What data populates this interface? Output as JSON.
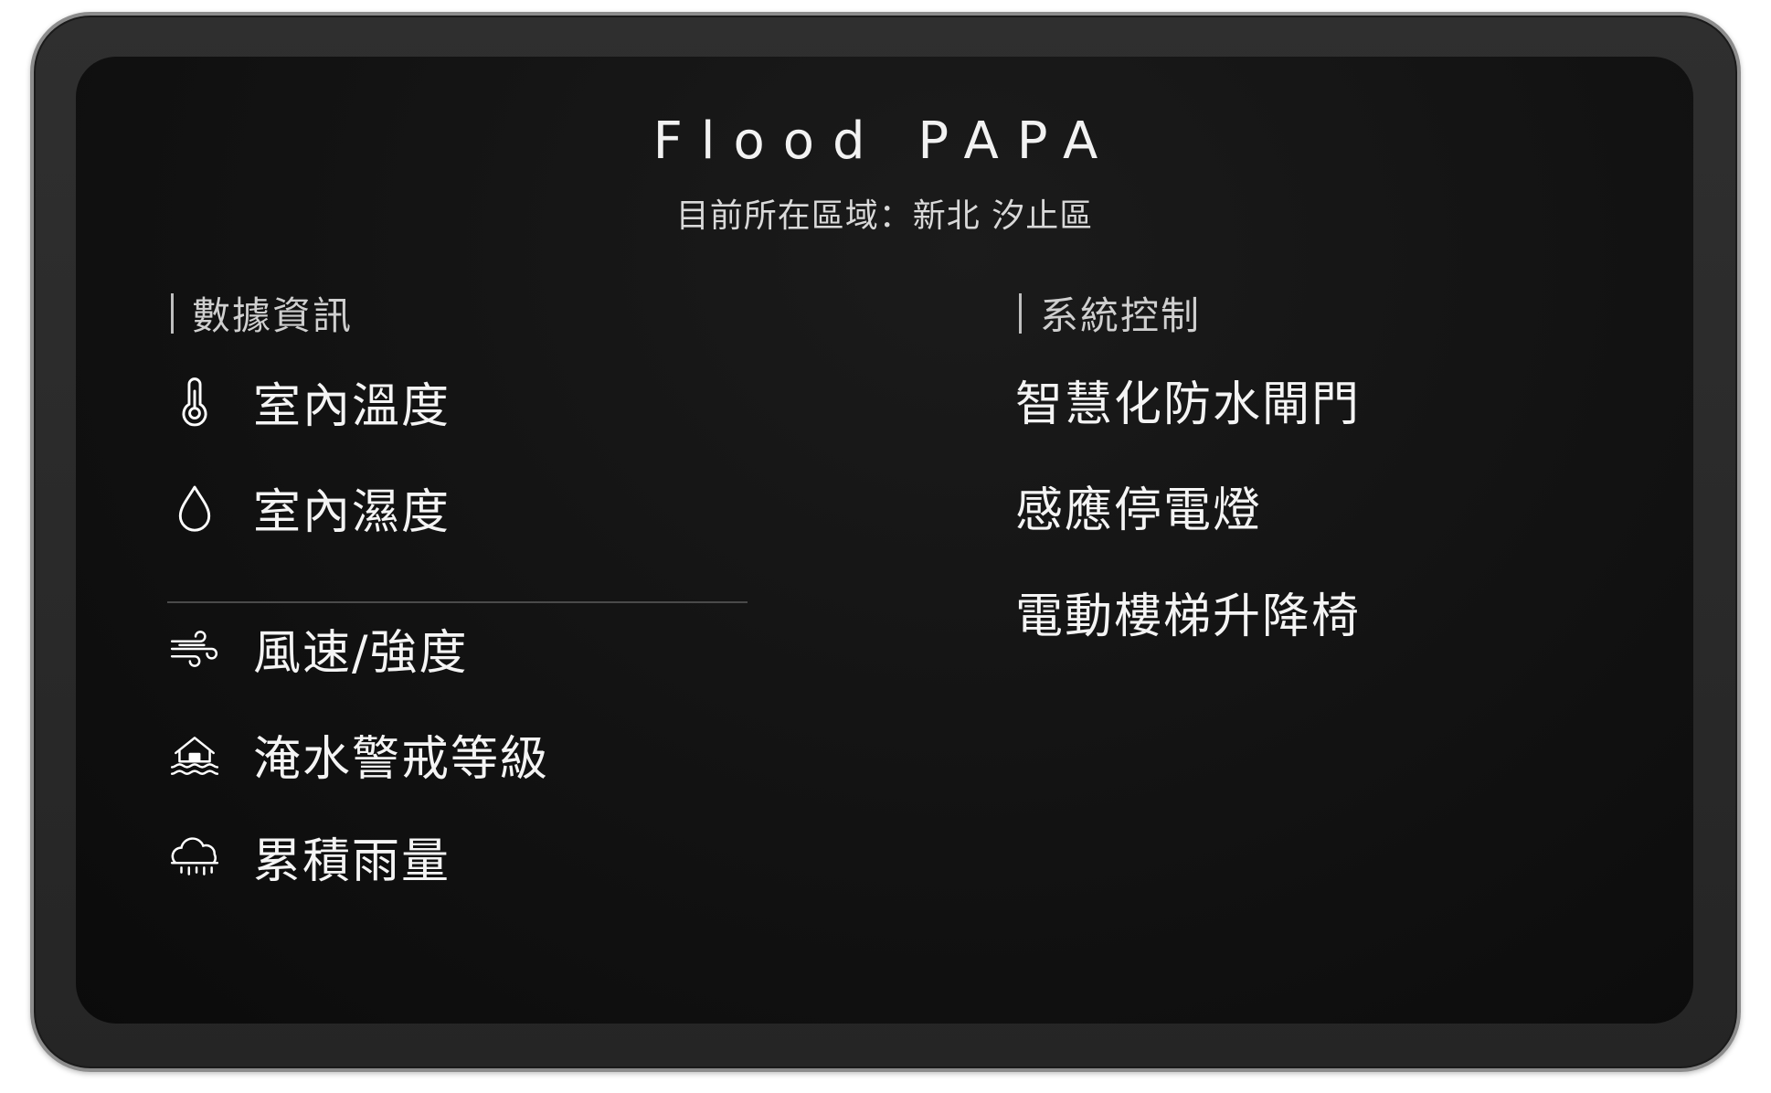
{
  "app": {
    "title": "Flood PAPA",
    "location_label": "目前所在區域：新北 汐止區"
  },
  "data_section": {
    "heading": "數據資訊",
    "items_top": [
      {
        "icon": "thermometer-icon",
        "label": "室內溫度"
      },
      {
        "icon": "water-drop-icon",
        "label": "室內濕度"
      }
    ],
    "items_bottom": [
      {
        "icon": "wind-icon",
        "label": "風速/強度"
      },
      {
        "icon": "flooded-house-icon",
        "label": "淹水警戒等級"
      },
      {
        "icon": "rain-cloud-icon",
        "label": "累積雨量"
      }
    ]
  },
  "control_section": {
    "heading": "系統控制",
    "items": [
      {
        "label": "智慧化防水閘門"
      },
      {
        "label": "感應停電燈"
      },
      {
        "label": "電動樓梯升降椅"
      }
    ]
  },
  "colors": {
    "screen_bg": "#121212",
    "bezel": "#2a2a2a",
    "text": "#f4f4f4",
    "muted_text": "#cfcfcf"
  }
}
